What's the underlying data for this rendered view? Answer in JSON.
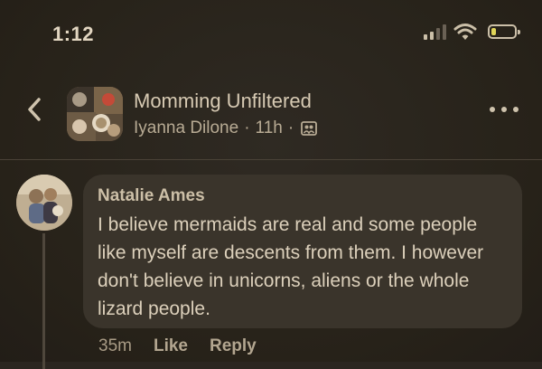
{
  "status_bar": {
    "time": "1:12",
    "battery_level": 0.2,
    "battery_color": "#e0d558",
    "signal_bars": 2,
    "icons": [
      "signal-icon",
      "wifi-icon",
      "battery-icon"
    ]
  },
  "header": {
    "back_icon": "chevron-left-icon",
    "group_name": "Momming Unfiltered",
    "poster_name": "Iyanna Dilone",
    "separator": "·",
    "time_ago": "11h",
    "audience_icon": "group-audience-icon",
    "more_icon": "more-horizontal-icon"
  },
  "comment": {
    "author": "Natalie Ames",
    "text": "I believe mermaids are real and some people like myself are descents from them. I however don't believe in unicorns, aliens or the whole lizard people.",
    "time_ago": "35m",
    "like_label": "Like",
    "reply_label": "Reply"
  },
  "colors": {
    "background": "#2b2620",
    "bubble": "#3a342b",
    "text": "#dcd0bb"
  }
}
